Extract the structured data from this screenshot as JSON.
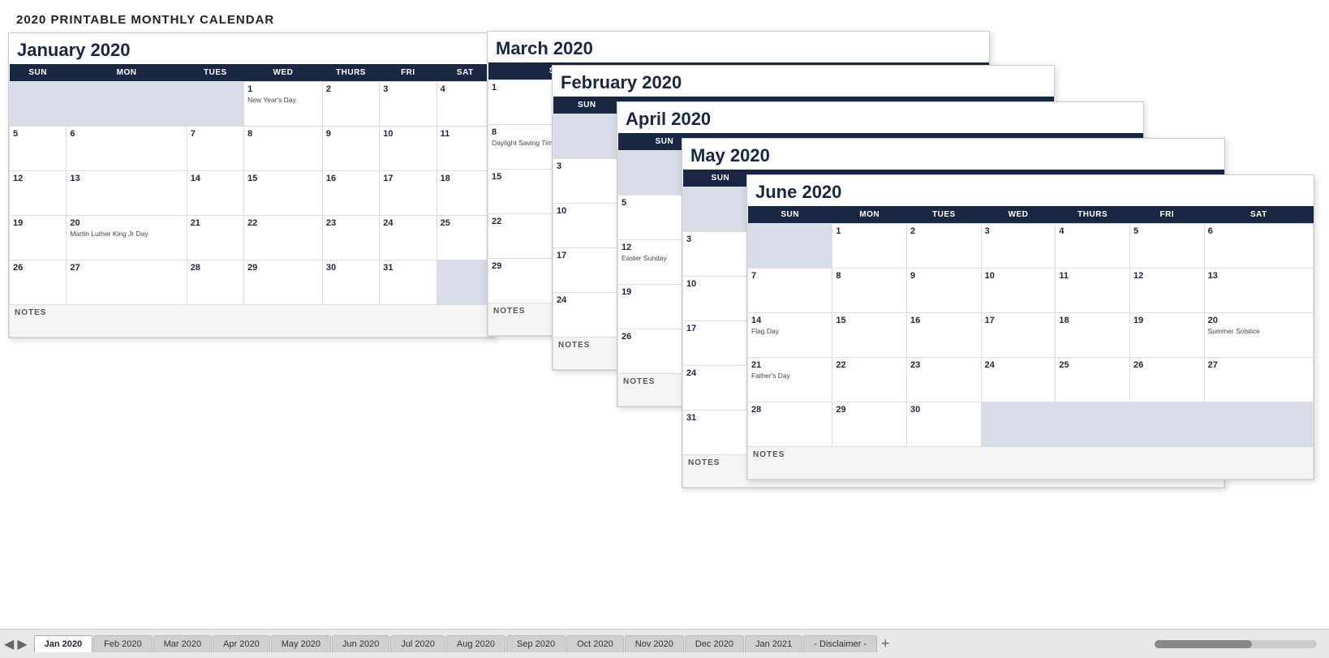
{
  "page": {
    "title": "2020 PRINTABLE MONTHLY CALENDAR"
  },
  "tabs": [
    {
      "label": "Jan 2020",
      "active": true
    },
    {
      "label": "Feb 2020",
      "active": false
    },
    {
      "label": "Mar 2020",
      "active": false
    },
    {
      "label": "Apr 2020",
      "active": false
    },
    {
      "label": "May 2020",
      "active": false
    },
    {
      "label": "Jun 2020",
      "active": false
    },
    {
      "label": "Jul 2020",
      "active": false
    },
    {
      "label": "Aug 2020",
      "active": false
    },
    {
      "label": "Sep 2020",
      "active": false
    },
    {
      "label": "Oct 2020",
      "active": false
    },
    {
      "label": "Nov 2020",
      "active": false
    },
    {
      "label": "Dec 2020",
      "active": false
    },
    {
      "label": "Jan 2021",
      "active": false
    },
    {
      "label": "- Disclaimer -",
      "active": false
    }
  ],
  "calendars": {
    "january": {
      "title": "January 2020"
    },
    "february": {
      "title": "February 2020"
    },
    "march": {
      "title": "March 2020"
    },
    "april": {
      "title": "April 2020"
    },
    "may": {
      "title": "May 2020"
    },
    "june": {
      "title": "June 2020"
    }
  },
  "notes_label": "NOTES"
}
